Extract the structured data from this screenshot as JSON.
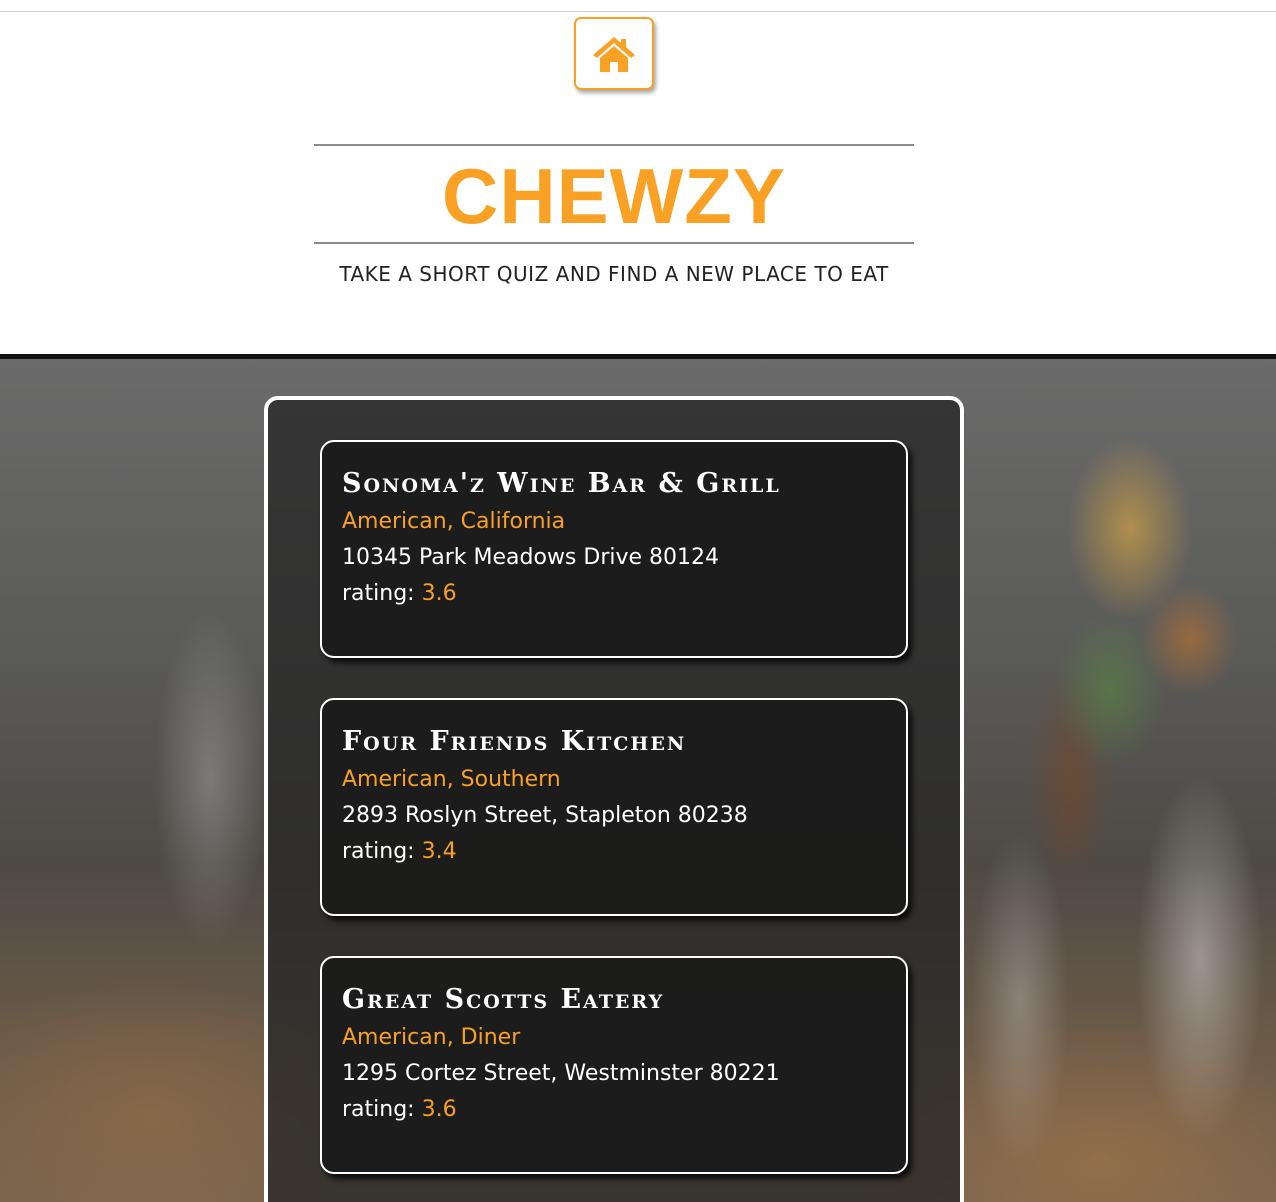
{
  "colors": {
    "accent": "#f8a125",
    "text_dark": "#222222",
    "card_text": "#ffffff"
  },
  "header": {
    "home_icon": "home-icon",
    "title": "CHEWZY",
    "tagline": "TAKE A SHORT QUIZ AND FIND A NEW PLACE TO EAT"
  },
  "restaurants": [
    {
      "name": "Sonoma'z Wine Bar & Grill",
      "cuisine": "American, California",
      "address": "10345 Park Meadows Drive 80124",
      "rating_label": "rating:",
      "rating": "3.6"
    },
    {
      "name": "Four Friends Kitchen",
      "cuisine": "American, Southern",
      "address": "2893 Roslyn Street, Stapleton 80238",
      "rating_label": "rating:",
      "rating": "3.4"
    },
    {
      "name": "Great Scotts Eatery",
      "cuisine": "American, Diner",
      "address": "1295 Cortez Street, Westminster 80221",
      "rating_label": "rating:",
      "rating": "3.6"
    }
  ]
}
